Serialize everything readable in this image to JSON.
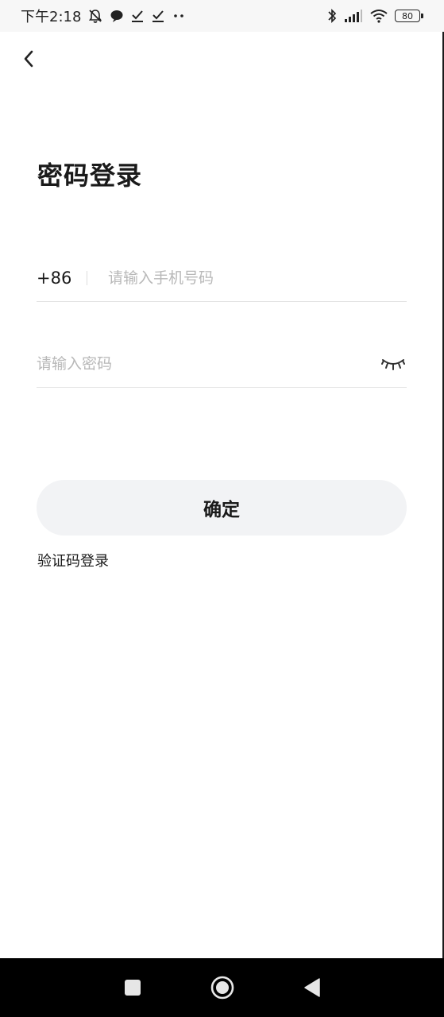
{
  "status_bar": {
    "time": "下午2:18",
    "battery_level": "80",
    "icons": [
      "mute-icon",
      "chat-icon",
      "check-icon",
      "check-icon",
      "more-dots-icon",
      "bluetooth-icon",
      "signal-icon",
      "wifi-icon",
      "battery-icon"
    ]
  },
  "header": {
    "back_icon": "chevron-left-icon"
  },
  "main": {
    "title": "密码登录",
    "phone": {
      "country_code": "+86",
      "placeholder": "请输入手机号码",
      "value": ""
    },
    "password": {
      "placeholder": "请输入密码",
      "value": "",
      "toggle_icon": "eye-closed-icon"
    },
    "confirm_label": "确定",
    "sms_login_label": "验证码登录"
  },
  "nav_bar": {
    "icons": [
      "recents-square-icon",
      "home-circle-icon",
      "back-triangle-icon"
    ]
  },
  "colors": {
    "button_bg": "#f2f3f5",
    "text": "#1a1a1a",
    "placeholder": "#b8b8b8",
    "divider": "#e3e3e3",
    "nav_bg": "#000000"
  }
}
